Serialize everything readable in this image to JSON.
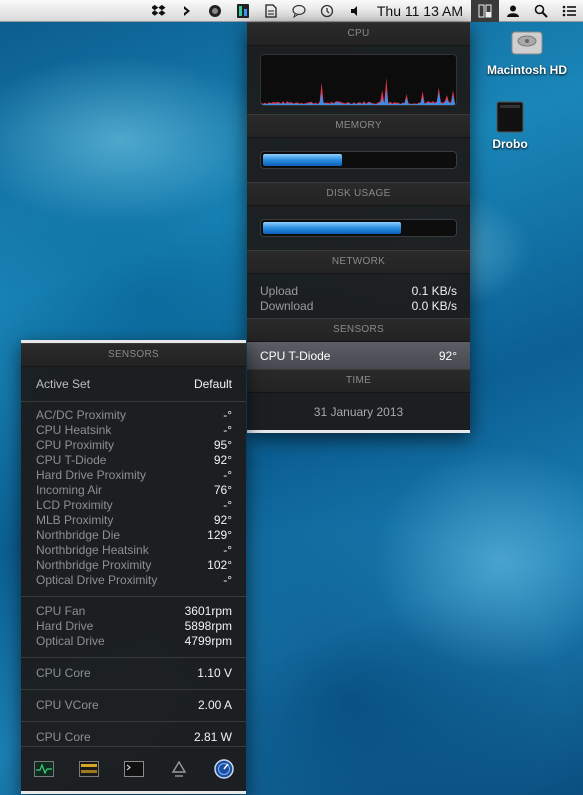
{
  "menubar": {
    "clock": "Thu 11 13 AM"
  },
  "desktop": {
    "icons": [
      {
        "label": "Macintosh HD"
      },
      {
        "label": "Drobo"
      }
    ]
  },
  "menu_panel": {
    "cpu": {
      "title": "CPU"
    },
    "memory": {
      "title": "MEMORY",
      "usage_fraction": 0.41
    },
    "disk": {
      "title": "DISK USAGE",
      "usage_fraction": 0.72
    },
    "network": {
      "title": "NETWORK",
      "upload_label": "Upload",
      "upload_value": "0.1 KB/s",
      "download_label": "Download",
      "download_value": "0.0 KB/s"
    },
    "sensors": {
      "title": "SENSORS",
      "label": "CPU T-Diode",
      "value": "92°"
    },
    "time": {
      "title": "TIME",
      "date": "31 January 2013"
    }
  },
  "sensors_panel": {
    "title": "SENSORS",
    "active_set": {
      "label": "Active Set",
      "value": "Default"
    },
    "temperatures": [
      {
        "label": "AC/DC Proximity",
        "value": "-°"
      },
      {
        "label": "CPU Heatsink",
        "value": "-°"
      },
      {
        "label": "CPU Proximity",
        "value": "95°"
      },
      {
        "label": "CPU T-Diode",
        "value": "92°"
      },
      {
        "label": "Hard Drive Proximity",
        "value": "-°"
      },
      {
        "label": "Incoming Air",
        "value": "76°"
      },
      {
        "label": "LCD Proximity",
        "value": "-°"
      },
      {
        "label": "MLB Proximity",
        "value": "92°"
      },
      {
        "label": "Northbridge Die",
        "value": "129°"
      },
      {
        "label": "Northbridge Heatsink",
        "value": "-°"
      },
      {
        "label": "Northbridge Proximity",
        "value": "102°"
      },
      {
        "label": "Optical Drive Proximity",
        "value": "-°"
      }
    ],
    "fans": [
      {
        "label": "CPU Fan",
        "value": "3601rpm"
      },
      {
        "label": "Hard Drive",
        "value": "5898rpm"
      },
      {
        "label": "Optical Drive",
        "value": "4799rpm"
      }
    ],
    "voltage": {
      "label": "CPU Core",
      "value": "1.10 V"
    },
    "current": {
      "label": "CPU VCore",
      "value": "2.00 A"
    },
    "power": {
      "label": "CPU Core",
      "value": "2.81 W"
    },
    "toolbar_icons": [
      "activity-monitor-icon",
      "console-clock-icon",
      "terminal-icon",
      "recycle-icon",
      "network-utility-icon"
    ]
  },
  "colors": {
    "cpu_user": "#e0324a",
    "cpu_system": "#3b8ee8",
    "bar_fill": "#2a8de0",
    "menubar_bg": "#e8e8e8"
  }
}
